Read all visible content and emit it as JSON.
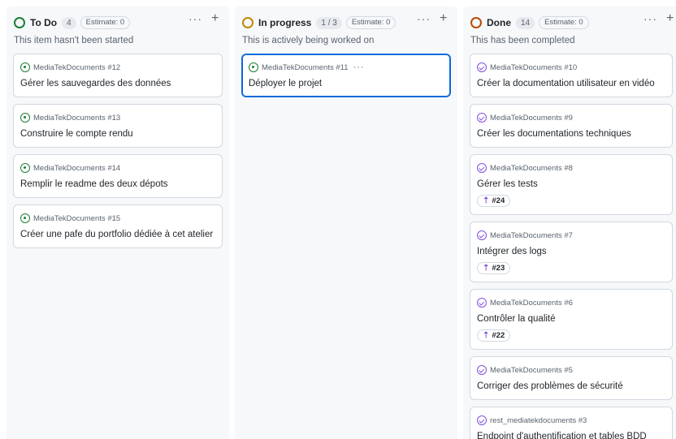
{
  "columns": [
    {
      "title": "To Do",
      "count": "4",
      "estimate": "Estimate: 0",
      "description": "This item hasn't been started",
      "status_color": "#1a7f37",
      "cards": [
        {
          "ref": "MediaTekDocuments #12",
          "title": "Gérer les sauvegardes des données",
          "state": "open"
        },
        {
          "ref": "MediaTekDocuments #13",
          "title": "Construire le compte rendu",
          "state": "open"
        },
        {
          "ref": "MediaTekDocuments #14",
          "title": "Remplir le readme des deux dépots",
          "state": "open"
        },
        {
          "ref": "MediaTekDocuments #15",
          "title": "Créer une pafe du portfolio dédiée à cet atelier",
          "state": "open"
        }
      ]
    },
    {
      "title": "In progress",
      "count": "1 / 3",
      "estimate": "Estimate: 0",
      "description": "This is actively being worked on",
      "status_color": "#bf8700",
      "cards": [
        {
          "ref": "MediaTekDocuments #11",
          "title": "Déployer le projet",
          "state": "open",
          "selected": true
        }
      ]
    },
    {
      "title": "Done",
      "count": "14",
      "estimate": "Estimate: 0",
      "description": "This has been completed",
      "status_color": "#bc4c00",
      "cards": [
        {
          "ref": "MediaTekDocuments #10",
          "title": "Créer la documentation utilisateur en vidéo",
          "state": "closed"
        },
        {
          "ref": "MediaTekDocuments #9",
          "title": "Créer les documentations techniques",
          "state": "closed"
        },
        {
          "ref": "MediaTekDocuments #8",
          "title": "Gérer les tests",
          "state": "closed",
          "pr": "#24"
        },
        {
          "ref": "MediaTekDocuments #7",
          "title": "Intégrer des logs",
          "state": "closed",
          "pr": "#23"
        },
        {
          "ref": "MediaTekDocuments #6",
          "title": "Contrôler la qualité",
          "state": "closed",
          "pr": "#22"
        },
        {
          "ref": "MediaTekDocuments #5",
          "title": "Corriger des problèmes de sécurité",
          "state": "closed"
        },
        {
          "ref": "rest_mediatekdocuments #3",
          "title": "Endpoint d'authentification et tables BDD",
          "state": "closed"
        }
      ]
    }
  ],
  "icons": {
    "more": "···",
    "add": "+",
    "pr": "⇡"
  }
}
